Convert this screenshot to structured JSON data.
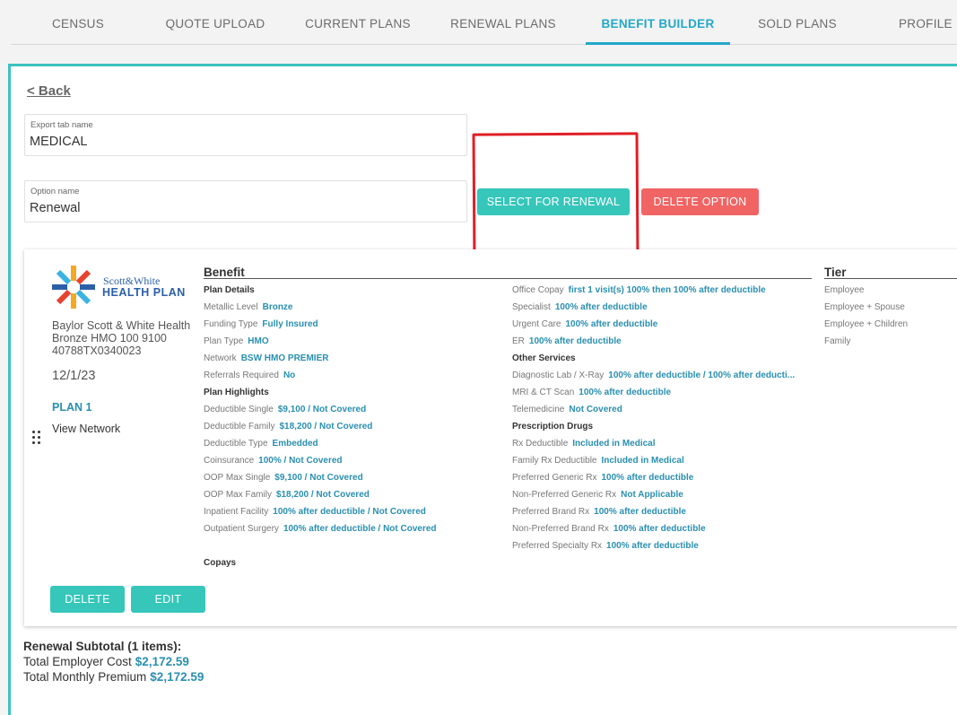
{
  "tabs": [
    "CENSUS",
    "QUOTE UPLOAD",
    "CURRENT PLANS",
    "RENEWAL PLANS",
    "BENEFIT BUILDER",
    "SOLD PLANS",
    "PROFILE"
  ],
  "active_tab": "BENEFIT BUILDER",
  "back_label": "< Back",
  "export_tab": {
    "label": "Export tab name",
    "value": "MEDICAL"
  },
  "option_name": {
    "label": "Option name",
    "value": "Renewal"
  },
  "buttons": {
    "select_renewal": "SELECT FOR RENEWAL",
    "delete_option": "DELETE OPTION",
    "delete": "DELETE",
    "edit": "EDIT"
  },
  "plan": {
    "logo_line1": "Scott&White",
    "logo_line2": "HEALTH PLAN",
    "name": "Baylor Scott & White Health Bronze HMO 100 9100 40788TX0340023",
    "date": "12/1/23",
    "label": "PLAN 1",
    "view_network": "View Network"
  },
  "benefit_header": "Benefit",
  "tier_header": "Tier",
  "col1": [
    {
      "type": "section",
      "text": "Plan Details"
    },
    {
      "type": "row",
      "label": "Metallic Level",
      "value": "Bronze"
    },
    {
      "type": "row",
      "label": "Funding Type",
      "value": "Fully Insured"
    },
    {
      "type": "row",
      "label": "Plan Type",
      "value": "HMO"
    },
    {
      "type": "row",
      "label": "Network",
      "value": "BSW HMO PREMIER"
    },
    {
      "type": "row",
      "label": "Referrals Required",
      "value": "No"
    },
    {
      "type": "section",
      "text": "Plan Highlights"
    },
    {
      "type": "row",
      "label": "Deductible Single",
      "value": "$9,100 / Not Covered"
    },
    {
      "type": "row",
      "label": "Deductible Family",
      "value": "$18,200 / Not Covered"
    },
    {
      "type": "row",
      "label": "Deductible Type",
      "value": "Embedded"
    },
    {
      "type": "row",
      "label": "Coinsurance",
      "value": "100% / Not Covered"
    },
    {
      "type": "row",
      "label": "OOP Max Single",
      "value": "$9,100 / Not Covered"
    },
    {
      "type": "row",
      "label": "OOP Max Family",
      "value": "$18,200 / Not Covered"
    },
    {
      "type": "row",
      "label": "Inpatient Facility",
      "value": "100% after deductible / Not Covered"
    },
    {
      "type": "row",
      "label": "Outpatient Surgery",
      "value": "100% after deductible / Not Covered"
    }
  ],
  "copays_label": "Copays",
  "col2": [
    {
      "type": "row",
      "label": "Office Copay",
      "value": "first 1 visit(s) 100% then 100% after deductible"
    },
    {
      "type": "row",
      "label": "Specialist",
      "value": "100% after deductible"
    },
    {
      "type": "row",
      "label": "Urgent Care",
      "value": "100% after deductible"
    },
    {
      "type": "row",
      "label": "ER",
      "value": "100% after deductible"
    },
    {
      "type": "section",
      "text": "Other Services"
    },
    {
      "type": "row",
      "label": "Diagnostic Lab / X-Ray",
      "value": "100% after deductible / 100% after deducti..."
    },
    {
      "type": "row",
      "label": "MRI & CT Scan",
      "value": "100% after deductible"
    },
    {
      "type": "row",
      "label": "Telemedicine",
      "value": "Not Covered"
    },
    {
      "type": "section",
      "text": "Prescription Drugs"
    },
    {
      "type": "row",
      "label": "Rx Deductible",
      "value": "Included in Medical"
    },
    {
      "type": "row",
      "label": "Family Rx Deductible",
      "value": "Included in Medical"
    },
    {
      "type": "row",
      "label": "Preferred Generic Rx",
      "value": "100% after deductible"
    },
    {
      "type": "row",
      "label": "Non-Preferred Generic Rx",
      "value": "Not Applicable"
    },
    {
      "type": "row",
      "label": "Preferred Brand Rx",
      "value": "100% after deductible"
    },
    {
      "type": "row",
      "label": "Non-Preferred Brand Rx",
      "value": "100% after deductible"
    },
    {
      "type": "row",
      "label": "Preferred Specialty Rx",
      "value": "100% after deductible"
    }
  ],
  "tiers": [
    "Employee",
    "Employee + Spouse",
    "Employee + Children",
    "Family"
  ],
  "summary": {
    "title": "Renewal Subtotal (1 items):",
    "employer_label": "Total Employer Cost",
    "employer_value": "$2,172.59",
    "premium_label": "Total Monthly Premium",
    "premium_value": "$2,172.59"
  }
}
